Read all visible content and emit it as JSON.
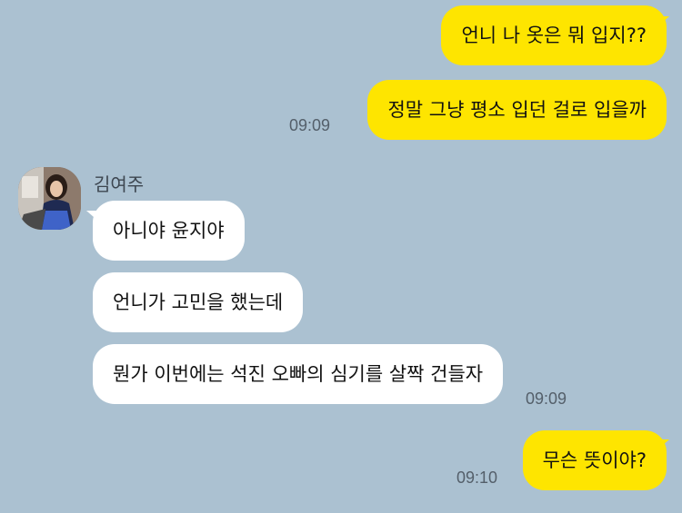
{
  "chat": {
    "messages": [
      {
        "text": "언니 나 옷은 뭐 입지??"
      },
      {
        "text": "정말 그냥 평소 입던 걸로 입을까",
        "time": "09:09"
      },
      {
        "text": "아니야 윤지야"
      },
      {
        "text": "언니가 고민을 했는데"
      },
      {
        "text": "뭔가 이번에는 석진 오빠의 심기를 살짝 건들자",
        "time": "09:09"
      },
      {
        "text": "무슨 뜻이야?",
        "time": "09:10"
      }
    ],
    "sender_name": "김여주"
  },
  "colors": {
    "background": "#abc1d1",
    "my_bubble": "#fee500",
    "their_bubble": "#ffffff"
  }
}
